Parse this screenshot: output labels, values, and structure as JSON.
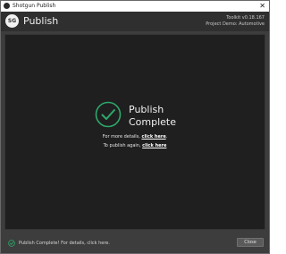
{
  "window": {
    "title": "Shotgun Publish",
    "close_glyph": "✕"
  },
  "header": {
    "logo_text": "SG",
    "title": "Publish",
    "toolkit_version": "Toolkit v0.18.167",
    "project": "Project Demo: Automotive"
  },
  "main": {
    "status_title": "Publish Complete",
    "details_prefix": "For more details,",
    "details_link": "click here",
    "details_suffix": ".",
    "again_prefix": "To publish again,",
    "again_link": "click here"
  },
  "footer": {
    "status_text": "Publish Complete! For details, click here.",
    "close_label": "Close"
  },
  "colors": {
    "accent_green": "#2ea86b",
    "background": "#1f1f1f",
    "panel": "#3d3d3d",
    "header": "#2f2f2f"
  },
  "icons": {
    "app": "shotgun-logo-icon",
    "window_close": "close-icon",
    "status": "check-circle-icon",
    "footer_status": "check-circle-icon"
  }
}
